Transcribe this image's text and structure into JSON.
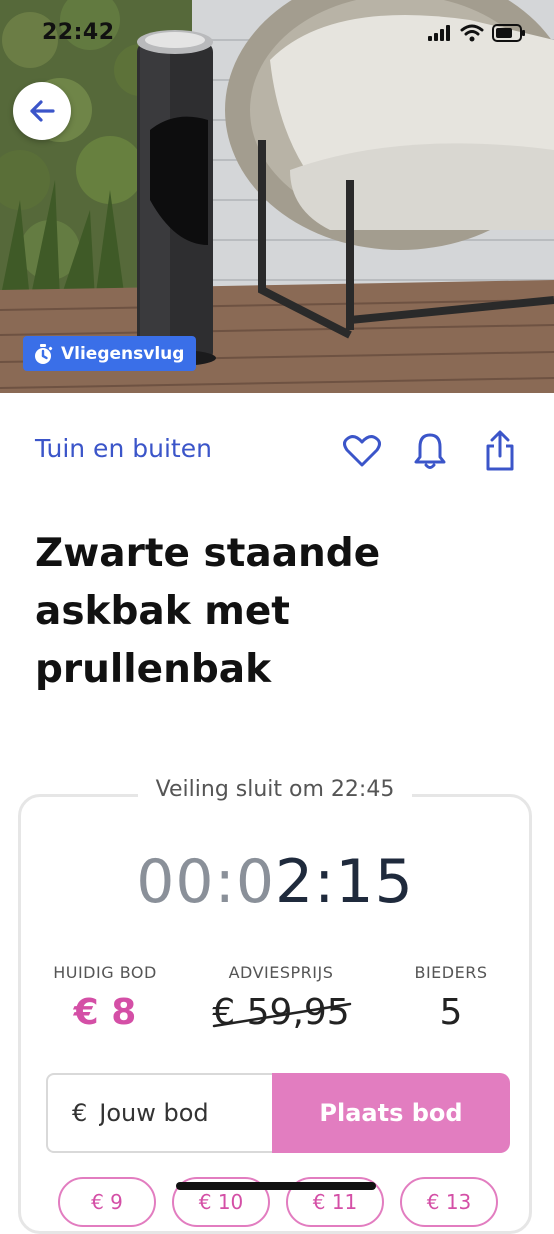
{
  "status_bar": {
    "time": "22:42"
  },
  "hero": {
    "back_icon": "arrow-left-icon",
    "badge_icon": "stopwatch-icon",
    "badge_label": "Vliegensvlug"
  },
  "product": {
    "category": "Tuin en buiten",
    "title": "Zwarte staande askbak met prullenbak",
    "action_icons": [
      "heart-icon",
      "bell-icon",
      "share-icon"
    ]
  },
  "auction": {
    "closes_label": "Veiling sluit om 22:45",
    "timer_dim": "00:0",
    "timer_bright": "2:15",
    "current_bid_label": "HUIDIG BOD",
    "current_bid_value": "€ 8",
    "advice_label": "ADVIESPRIJS",
    "advice_value": "€ 59,95",
    "bidders_label": "BIEDERS",
    "bidders_value": "5",
    "bid_currency": "€",
    "bid_placeholder": "Jouw bod",
    "place_bid_label": "Plaats bod",
    "quick_bids": [
      "€ 9",
      "€ 10",
      "€ 11",
      "€ 13"
    ]
  },
  "colors": {
    "accent_blue": "#3b55c9",
    "badge_blue": "#3a6fe8",
    "bid_pink": "#d44fa6",
    "button_pink": "#e27dc0"
  }
}
